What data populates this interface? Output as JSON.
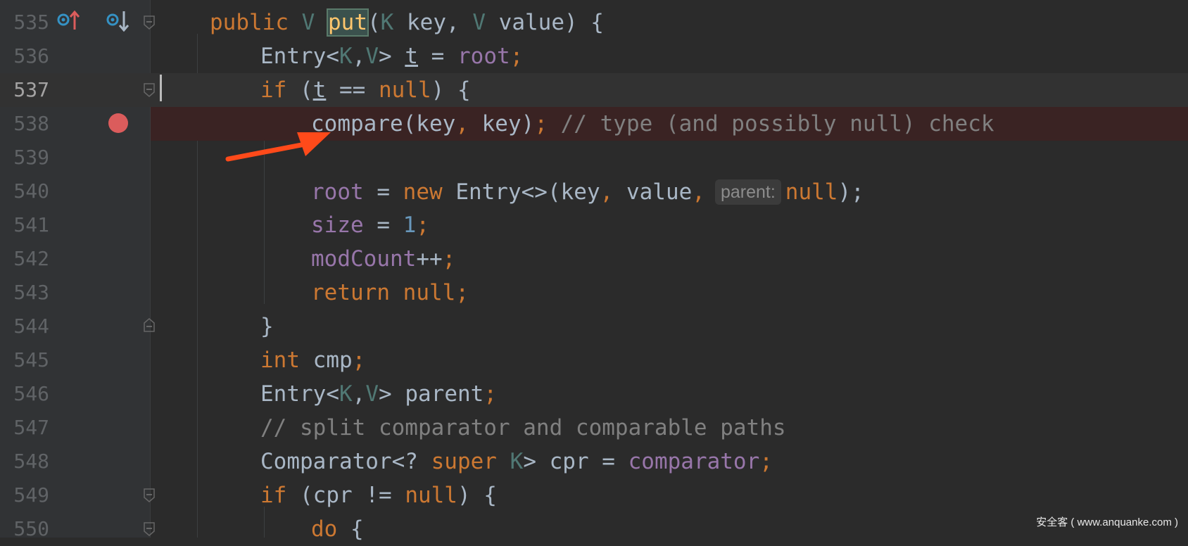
{
  "editor": {
    "lines": [
      {
        "num": "535"
      },
      {
        "num": "536"
      },
      {
        "num": "537"
      },
      {
        "num": "538"
      },
      {
        "num": "539"
      },
      {
        "num": "540"
      },
      {
        "num": "541"
      },
      {
        "num": "542"
      },
      {
        "num": "543"
      },
      {
        "num": "544"
      },
      {
        "num": "545"
      },
      {
        "num": "546"
      },
      {
        "num": "547"
      },
      {
        "num": "548"
      },
      {
        "num": "549"
      },
      {
        "num": "550"
      }
    ],
    "current_line": "537",
    "breakpoint_line": "538",
    "inlay_hint": "parent:",
    "code": {
      "l535": {
        "kw1": "public",
        "t1": "V",
        "method": "put",
        "p1": "(",
        "t2": "K",
        "a1": " key, ",
        "t3": "V",
        "a2": " value) {"
      },
      "l536": {
        "a1": "Entry<",
        "t1": "K",
        "c1": ",",
        "t2": "V",
        "a2": "> ",
        "var": "t",
        "a3": " = ",
        "fld": "root",
        "a4": ";"
      },
      "l537": {
        "kw1": "if",
        "a1": " (",
        "var": "t",
        "a2": " == ",
        "kw2": "null",
        "a3": ") {"
      },
      "l538": {
        "a1": "compare(key",
        "c1": ",",
        "a2": " key)",
        "c2": ";",
        "cmt": " // type (and possibly null) check"
      },
      "l540": {
        "fld": "root",
        "a1": " = ",
        "kw1": "new",
        "a2": " Entry<>(key",
        "c1": ",",
        "a3": " value",
        "c2": ",",
        "kw2": "null",
        "a4": ");"
      },
      "l541": {
        "fld": "size",
        "a1": " = ",
        "num": "1",
        "a2": ";"
      },
      "l542": {
        "fld": "modCount",
        "a1": "++",
        "a2": ";"
      },
      "l543": {
        "kw1": "return",
        "a1": " ",
        "kw2": "null",
        "a2": ";"
      },
      "l544": {
        "a1": "}"
      },
      "l545": {
        "kw1": "int",
        "a1": " cmp",
        "a2": ";"
      },
      "l546": {
        "a1": "Entry<",
        "t1": "K",
        "c1": ",",
        "t2": "V",
        "a2": "> parent",
        "a3": ";"
      },
      "l547": {
        "cmt": "// split comparator and comparable paths"
      },
      "l548": {
        "a1": "Comparator<? ",
        "kw1": "super",
        "a2": " ",
        "t1": "K",
        "a3": "> cpr = ",
        "fld": "comparator",
        "a4": ";"
      },
      "l549": {
        "kw1": "if",
        "a1": " (cpr != ",
        "kw2": "null",
        "a2": ") {"
      },
      "l550": {
        "kw1": "do",
        "a1": " {"
      }
    }
  },
  "watermark": "安全客 ( www.anquanke.com )",
  "colors": {
    "background": "#2b2b2b",
    "keyword": "#cc7832",
    "type_param": "#507874",
    "field": "#9876aa",
    "number": "#6897bb",
    "comment": "#808080",
    "method": "#ffc66d",
    "breakpoint": "#db5c5c",
    "annotation_arrow": "#ff4a1a"
  },
  "icons": [
    "override-up-icon",
    "implemented-down-icon",
    "breakpoint-icon",
    "fold-icon",
    "arrow-annotation"
  ]
}
